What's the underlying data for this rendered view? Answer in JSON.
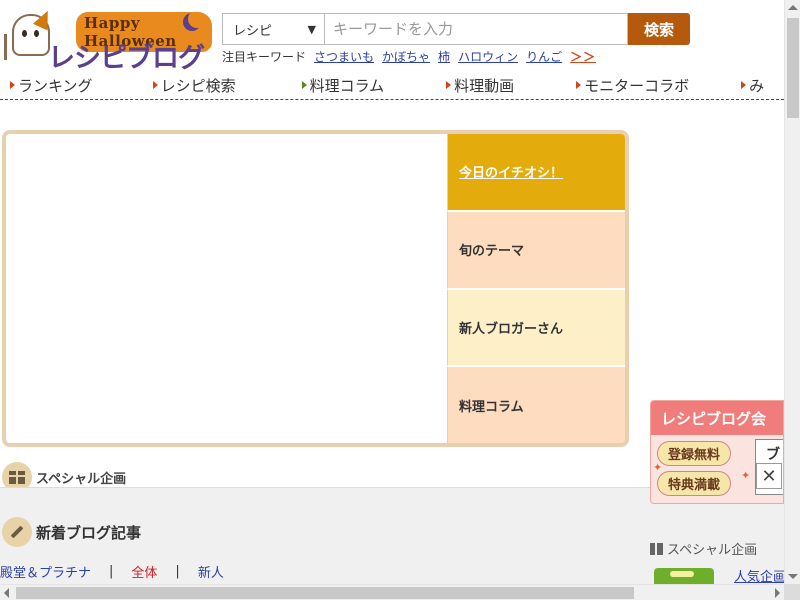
{
  "header": {
    "logo_halloween": "Happy Halloween",
    "logo_main": "レシピブログ",
    "search_category": "レシピ",
    "search_placeholder": "キーワードを入力",
    "search_button": "検索",
    "keyword_label": "注目キーワード",
    "keywords": [
      "さつまいも",
      "かぼちゃ",
      "柿",
      "ハロウィン",
      "りんご"
    ],
    "keyword_more": "＞＞"
  },
  "nav": {
    "items": [
      "ランキング",
      "レシピ検索",
      "料理コラム",
      "料理動画",
      "モニターコラボ",
      "み"
    ]
  },
  "feature": {
    "tabs": [
      "今日のイチオシ！",
      "旬のテーマ",
      "新人ブロガーさん",
      "料理コラム"
    ]
  },
  "sections": {
    "special_title": "スペシャル企画",
    "news_title": "新着ブログ記事",
    "news_tabs": [
      "殿堂＆プラチナ",
      "全体",
      "新人"
    ],
    "separator": "|"
  },
  "sidebar": {
    "special_title": "スペシャル企画",
    "link_text": "人気企画"
  },
  "promo": {
    "title": "レシピブログ会",
    "pill1": "登録無料",
    "pill2": "特典満載",
    "side_text": "ブ",
    "close": "✕"
  },
  "colors": {
    "accent_orange": "#b5590c",
    "tab_active": "#e3ab0c",
    "tab_peach": "#fddcbf",
    "tab_cream": "#fdf0c8",
    "link_blue": "#2a3fa8",
    "promo_red": "#f07c7c"
  }
}
